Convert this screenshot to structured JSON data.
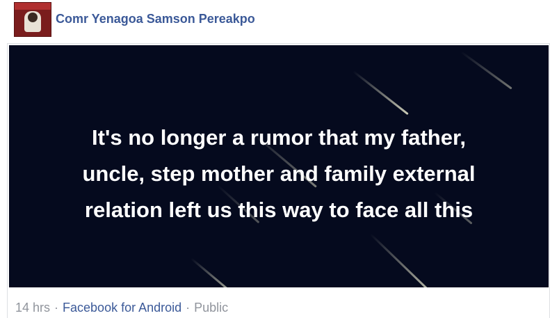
{
  "post": {
    "author_name": "Comr Yenagoa Samson Pereakpo",
    "image_text_lines": [
      "It's no longer a rumor that my father,",
      "uncle, step mother and family external",
      "relation left us this way to face all this"
    ],
    "timestamp": "14 hrs",
    "separator": "·",
    "source": "Facebook for Android",
    "privacy": "Public"
  },
  "colors": {
    "link": "#3b5998",
    "meta_text": "#90949c",
    "image_background": "#050a1e"
  }
}
